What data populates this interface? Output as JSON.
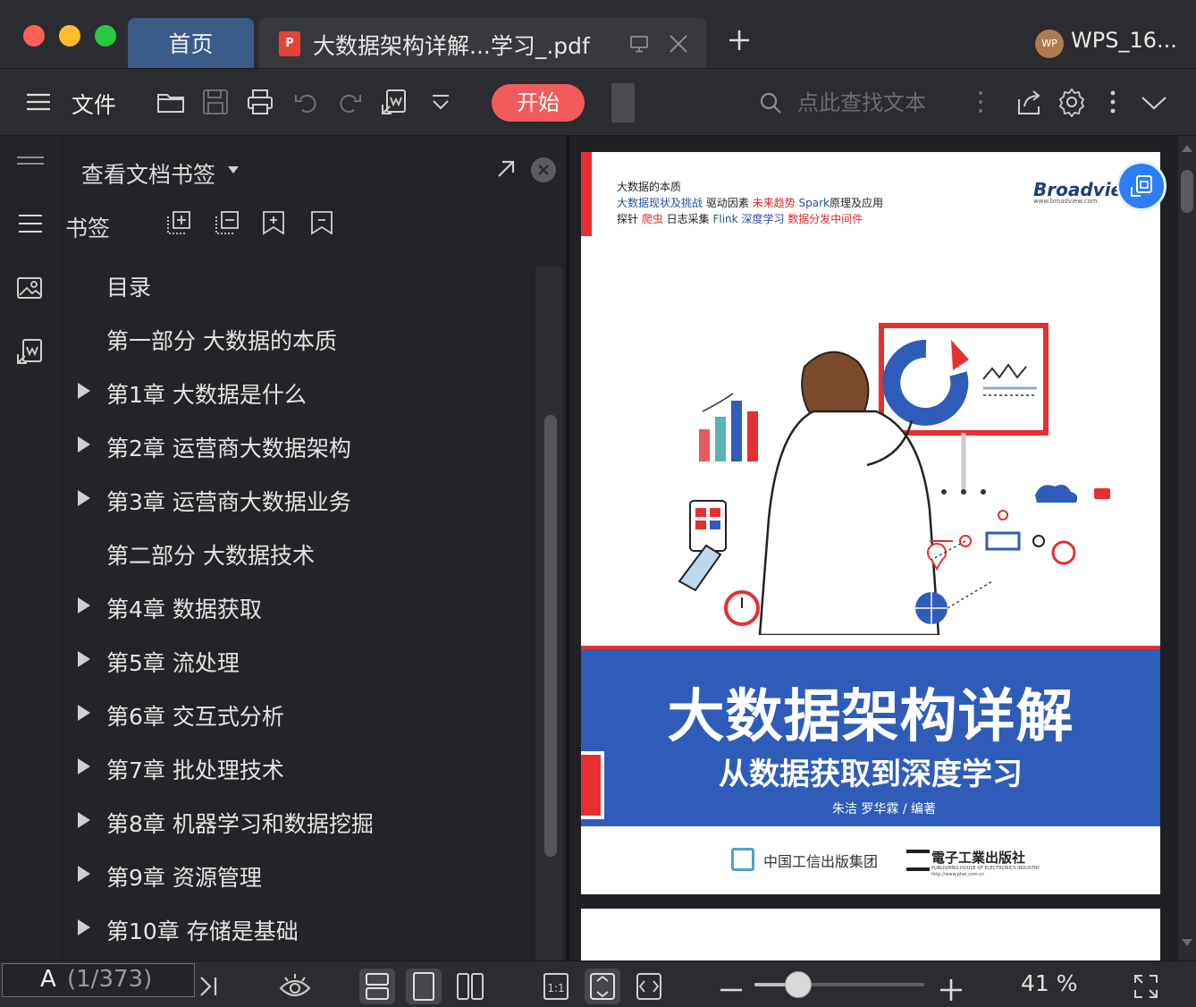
{
  "titlebar": {
    "home_tab": "首页",
    "doc_tab_title": "大数据架构详解...学习_.pdf",
    "pdf_badge": "P",
    "user_name": "WPS_16...",
    "user_avatar": "WP"
  },
  "toolbar": {
    "file_label": "文件",
    "start_label": "开始",
    "search_placeholder": "点此查找文本"
  },
  "bookmarks": {
    "panel_title": "查看文档书签",
    "section_label": "书签",
    "items": [
      {
        "text": "目录",
        "expandable": false
      },
      {
        "text": "第一部分 大数据的本质",
        "expandable": false
      },
      {
        "text": "第1章 大数据是什么",
        "expandable": true
      },
      {
        "text": "第2章 运营商大数据架构",
        "expandable": true
      },
      {
        "text": "第3章 运营商大数据业务",
        "expandable": true
      },
      {
        "text": "第二部分 大数据技术",
        "expandable": false
      },
      {
        "text": "第4章 数据获取",
        "expandable": true
      },
      {
        "text": "第5章 流处理",
        "expandable": true
      },
      {
        "text": "第6章 交互式分析",
        "expandable": true
      },
      {
        "text": "第7章 批处理技术",
        "expandable": true
      },
      {
        "text": "第8章 机器学习和数据挖掘",
        "expandable": true
      },
      {
        "text": "第9章 资源管理",
        "expandable": true
      },
      {
        "text": "第10章 存储是基础",
        "expandable": true
      }
    ]
  },
  "cover": {
    "topics_line1": "大数据的本质",
    "topics_line2": [
      {
        "t": "大数据现状及挑战",
        "c": "blue"
      },
      {
        "t": "  驱动因素  ",
        "c": "dark"
      },
      {
        "t": "未来趋势",
        "c": "red"
      },
      {
        "t": "  Spark",
        "c": "blue"
      },
      {
        "t": "原理及应用",
        "c": "dark"
      }
    ],
    "topics_line3": [
      {
        "t": "探针  ",
        "c": "dark"
      },
      {
        "t": "爬虫",
        "c": "red"
      },
      {
        "t": "  日志采集  ",
        "c": "dark"
      },
      {
        "t": "  Flink  ",
        "c": "blue"
      },
      {
        "t": "深度学习",
        "c": "blue"
      },
      {
        "t": "  数据分发中间件",
        "c": "red"
      }
    ],
    "publisher_logo": "Broadvie",
    "publisher_url": "www.broadview.com.",
    "title": "大数据架构详解",
    "subtitle": "从数据获取到深度学习",
    "authors": "朱洁   罗华霖 / 编著",
    "publisher_group": "中国工信出版集团",
    "publisher_house": "電子工業出版社",
    "publisher_house_en": "PUBLISHING HOUSE OF ELECTRONICS INDUSTRY",
    "publisher_house_url": "http://www.phei.com.cn"
  },
  "status": {
    "page_prefix": "A",
    "page_indicator": "(1/373)",
    "zoom_percent": "41 %",
    "zoom_level": 0.26
  },
  "colors": {
    "accent_start": "#f25b5b",
    "home_tab": "#3b5b88",
    "cover_band": "#2f5cb8",
    "cover_red": "#e62f31"
  }
}
